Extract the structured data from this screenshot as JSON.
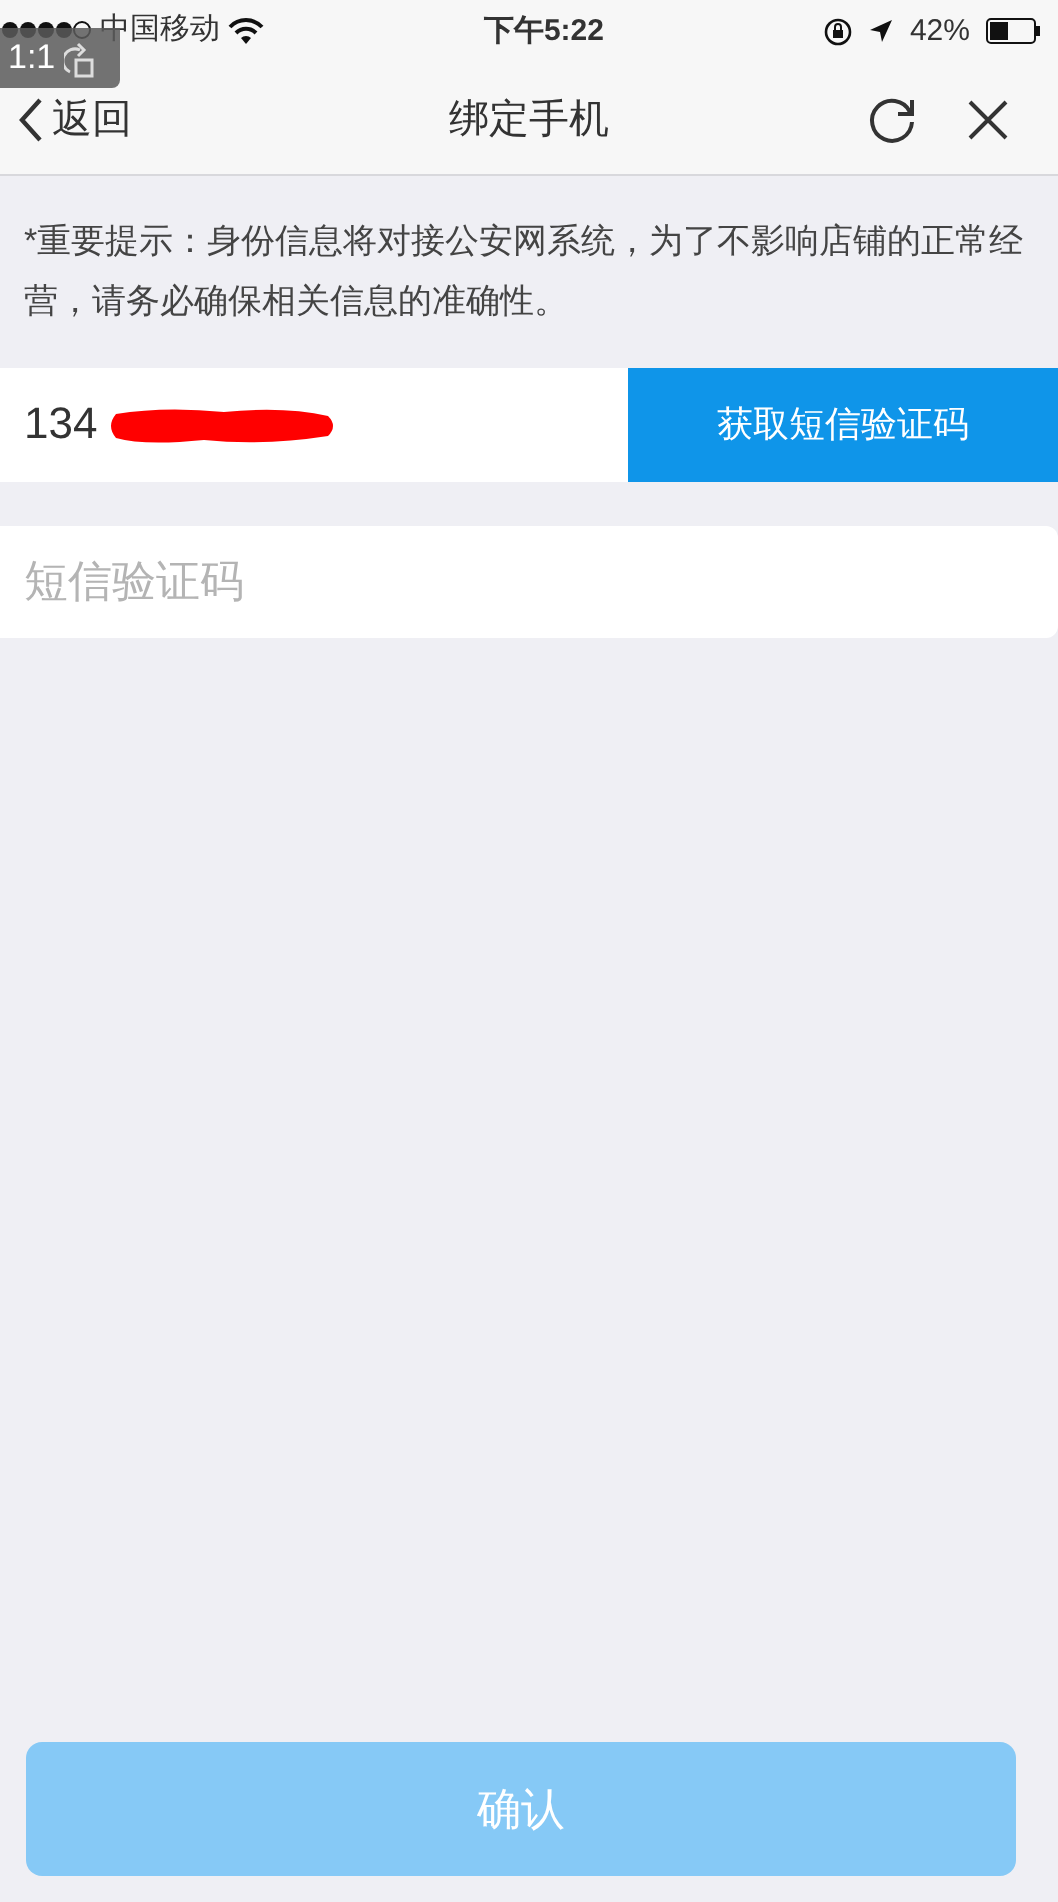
{
  "viewer_badge": {
    "text": "1:1"
  },
  "status_bar": {
    "carrier": "中国移动",
    "time": "下午5:22",
    "battery": "42%"
  },
  "nav_bar": {
    "back": "返回",
    "title": "绑定手机"
  },
  "notice": "*重要提示：身份信息将对接公安网系统，为了不影响店铺的正常经营，请务必确保相关信息的准确性。",
  "phone_field": {
    "value": "134",
    "redacted": true
  },
  "sms_button": {
    "label": "获取短信验证码"
  },
  "code_field": {
    "placeholder": "短信验证码"
  },
  "confirm_button": {
    "label": "确认",
    "disabled": true
  }
}
